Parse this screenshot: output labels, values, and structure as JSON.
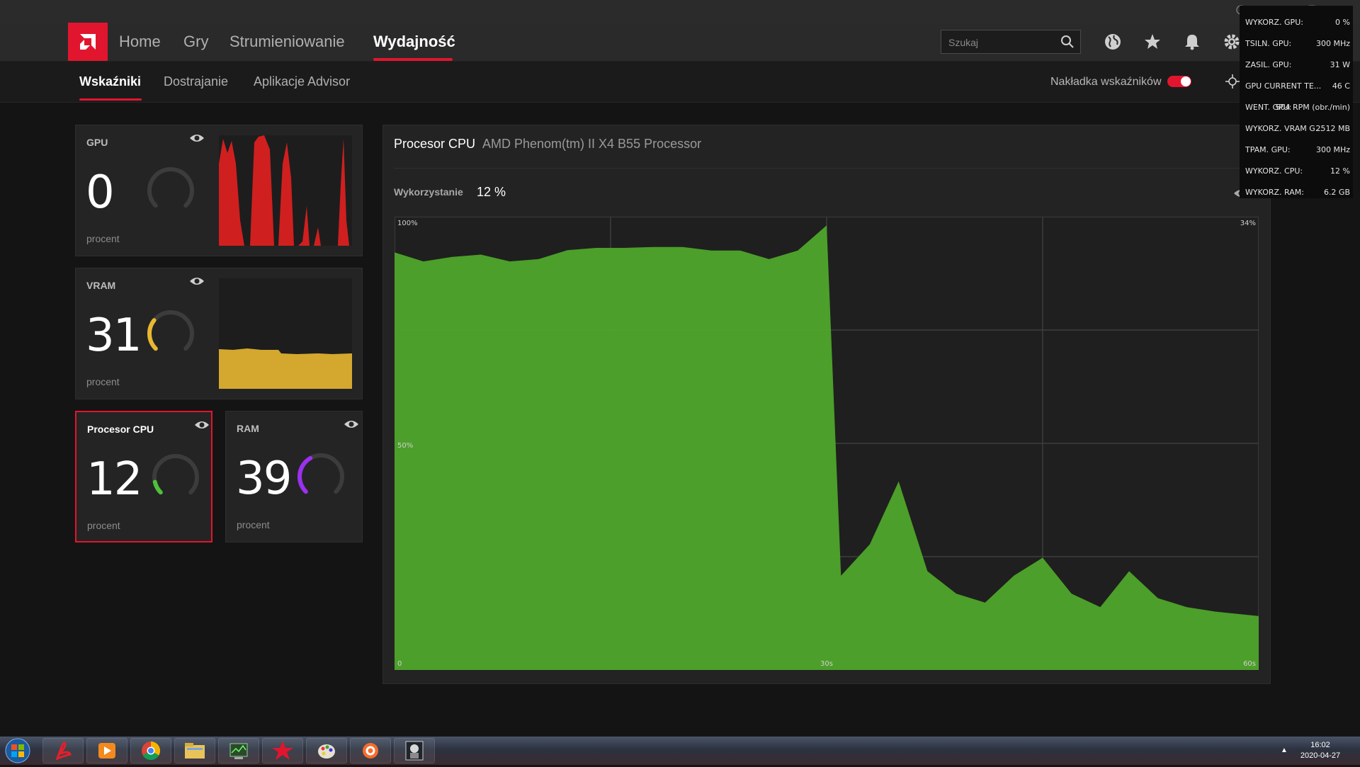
{
  "nav": {
    "items": [
      {
        "label": "Home"
      },
      {
        "label": "Gry"
      },
      {
        "label": "Strumieniowanie"
      },
      {
        "label": "Wydajność",
        "active": true
      }
    ],
    "search_placeholder": "Szukaj",
    "icons": [
      "globe-icon",
      "star-icon",
      "bell-icon",
      "gear-icon"
    ]
  },
  "subnav": {
    "items": [
      {
        "label": "Wskaźniki",
        "active": true
      },
      {
        "label": "Dostrajanie"
      },
      {
        "label": "Aplikacje Advisor"
      }
    ],
    "overlay_label": "Nakładka wskaźników",
    "overlay_on": true
  },
  "tiles": {
    "gpu": {
      "name": "GPU",
      "value": "0",
      "unit": "procent",
      "fraction": 0.0,
      "color": "#d01f1f"
    },
    "vram": {
      "name": "VRAM",
      "value": "31",
      "unit": "procent",
      "fraction": 0.31,
      "color": "#e8b830"
    },
    "cpu": {
      "name": "Procesor CPU",
      "value": "12",
      "unit": "procent",
      "fraction": 0.12,
      "color": "#4fc03a"
    },
    "ram": {
      "name": "RAM",
      "value": "39",
      "unit": "procent",
      "fraction": 0.39,
      "color": "#9b30f0"
    }
  },
  "main": {
    "title": "Procesor CPU",
    "subtitle": "AMD Phenom(tm) II X4 B55 Processor",
    "usage_label": "Wykorzystanie",
    "usage_value": "12 %"
  },
  "chart_data": {
    "type": "area",
    "xlabels": [
      "0",
      "30s",
      "60s"
    ],
    "ylabels": [
      "100%",
      "50%"
    ],
    "right_label": "34%",
    "xlim": [
      0,
      60
    ],
    "ylim": [
      0,
      100
    ],
    "color": "#4fa62b",
    "x": [
      0,
      2,
      4,
      6,
      8,
      10,
      12,
      14,
      16,
      18,
      20,
      22,
      24,
      26,
      28,
      30,
      31,
      33,
      35,
      37,
      39,
      41,
      43,
      45,
      47,
      49,
      51,
      53,
      55,
      57,
      60
    ],
    "y": [
      93,
      91,
      92,
      92.5,
      91,
      91.5,
      93.5,
      94,
      94,
      94.2,
      94.2,
      93.4,
      93.4,
      91.5,
      93.4,
      99,
      21,
      28,
      42,
      22,
      17,
      15,
      21,
      25,
      17,
      14,
      22,
      16,
      14,
      13,
      12
    ]
  },
  "osd": {
    "rows": [
      {
        "label": "WYKORZ. GPU:",
        "value": "0 %"
      },
      {
        "label": "TSILN. GPU:",
        "value": "300 MHz"
      },
      {
        "label": "ZASIL. GPU:",
        "value": "31 W"
      },
      {
        "label": "GPU CURRENT TE...",
        "value": "46 C"
      },
      {
        "label": "WENT. GPU:",
        "value": "504 RPM (obr./min)"
      },
      {
        "label": "WYKORZ. VRAM G...",
        "value": "2512 MB"
      },
      {
        "label": "TPAM. GPU:",
        "value": "300 MHz"
      },
      {
        "label": "WYKORZ. CPU:",
        "value": "12 %"
      },
      {
        "label": "WYKORZ. RAM:",
        "value": "6.2 GB"
      }
    ]
  },
  "taskbar": {
    "apps": [
      "windows-start-icon",
      "acrobat-icon",
      "media-player-icon",
      "chrome-icon",
      "file-explorer-icon",
      "task-manager-icon",
      "amd-radeon-icon",
      "paint-icon",
      "origin-icon",
      "game-icon"
    ],
    "time": "16:02",
    "date": "2020-04-27"
  }
}
